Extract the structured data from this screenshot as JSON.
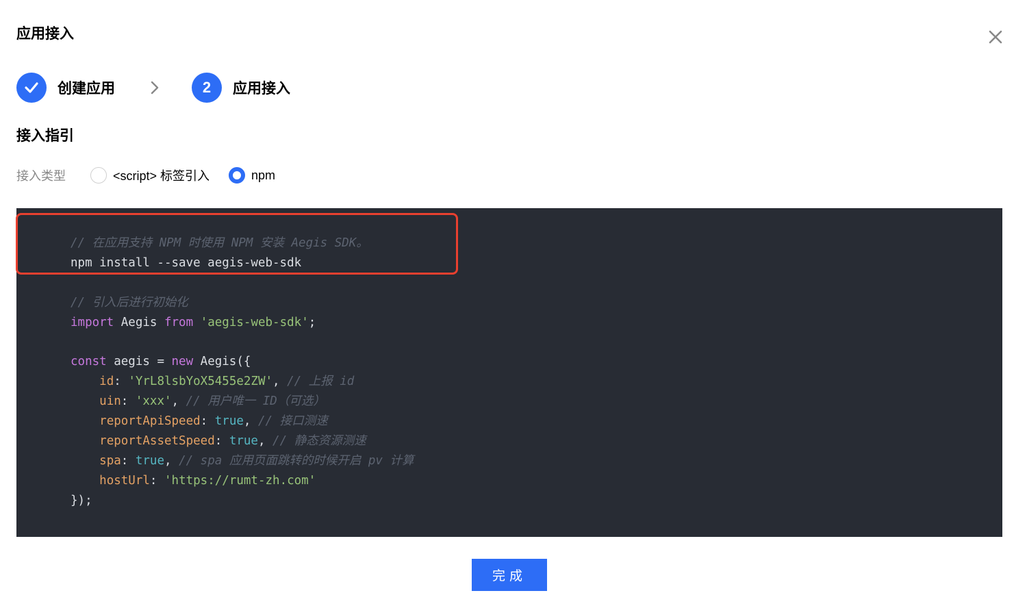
{
  "dialog": {
    "title": "应用接入",
    "close_icon": "close-icon"
  },
  "steps": [
    {
      "label": "创建应用",
      "status": "done",
      "icon": "check-icon"
    },
    {
      "label": "应用接入",
      "status": "current",
      "number": "2"
    }
  ],
  "guide": {
    "section_title": "接入指引",
    "type_label": "接入类型",
    "options": [
      {
        "label": "<script> 标签引入",
        "selected": false
      },
      {
        "label": "npm",
        "selected": true
      }
    ]
  },
  "code": {
    "lines": [
      {
        "indent": "",
        "tokens": [
          {
            "t": "comment",
            "v": "// 在应用支持 NPM 时使用 NPM 安装 Aegis SDK。"
          }
        ]
      },
      {
        "indent": "",
        "tokens": [
          {
            "t": "plain",
            "v": "npm install --save aegis-web-sdk"
          }
        ]
      },
      {
        "indent": "",
        "tokens": []
      },
      {
        "indent": "",
        "tokens": [
          {
            "t": "comment",
            "v": "// 引入后进行初始化"
          }
        ]
      },
      {
        "indent": "",
        "tokens": [
          {
            "t": "kw",
            "v": "import"
          },
          {
            "t": "plain",
            "v": " Aegis "
          },
          {
            "t": "kw",
            "v": "from"
          },
          {
            "t": "plain",
            "v": " "
          },
          {
            "t": "str",
            "v": "'aegis-web-sdk'"
          },
          {
            "t": "plain",
            "v": ";"
          }
        ]
      },
      {
        "indent": "",
        "tokens": []
      },
      {
        "indent": "",
        "tokens": [
          {
            "t": "kw",
            "v": "const"
          },
          {
            "t": "plain",
            "v": " aegis = "
          },
          {
            "t": "kw",
            "v": "new"
          },
          {
            "t": "plain",
            "v": " Aegis({"
          }
        ]
      },
      {
        "indent": "    ",
        "tokens": [
          {
            "t": "prop",
            "v": "id"
          },
          {
            "t": "plain",
            "v": ": "
          },
          {
            "t": "str",
            "v": "'YrL8lsbYoX5455e2ZW'"
          },
          {
            "t": "plain",
            "v": ", "
          },
          {
            "t": "comment",
            "v": "// 上报 id"
          }
        ]
      },
      {
        "indent": "    ",
        "tokens": [
          {
            "t": "prop",
            "v": "uin"
          },
          {
            "t": "plain",
            "v": ": "
          },
          {
            "t": "str",
            "v": "'xxx'"
          },
          {
            "t": "plain",
            "v": ", "
          },
          {
            "t": "comment",
            "v": "// 用户唯一 ID（可选）"
          }
        ]
      },
      {
        "indent": "    ",
        "tokens": [
          {
            "t": "prop",
            "v": "reportApiSpeed"
          },
          {
            "t": "plain",
            "v": ": "
          },
          {
            "t": "bool",
            "v": "true"
          },
          {
            "t": "plain",
            "v": ", "
          },
          {
            "t": "comment",
            "v": "// 接口测速"
          }
        ]
      },
      {
        "indent": "    ",
        "tokens": [
          {
            "t": "prop",
            "v": "reportAssetSpeed"
          },
          {
            "t": "plain",
            "v": ": "
          },
          {
            "t": "bool",
            "v": "true"
          },
          {
            "t": "plain",
            "v": ", "
          },
          {
            "t": "comment",
            "v": "// 静态资源测速"
          }
        ]
      },
      {
        "indent": "    ",
        "tokens": [
          {
            "t": "prop",
            "v": "spa"
          },
          {
            "t": "plain",
            "v": ": "
          },
          {
            "t": "bool",
            "v": "true"
          },
          {
            "t": "plain",
            "v": ", "
          },
          {
            "t": "comment",
            "v": "// spa 应用页面跳转的时候开启 pv 计算"
          }
        ]
      },
      {
        "indent": "    ",
        "tokens": [
          {
            "t": "prop",
            "v": "hostUrl"
          },
          {
            "t": "plain",
            "v": ": "
          },
          {
            "t": "str",
            "v": "'https://rumt-zh.com'"
          }
        ]
      },
      {
        "indent": "",
        "tokens": [
          {
            "t": "plain",
            "v": "});"
          }
        ]
      }
    ]
  },
  "footer": {
    "done_label": "完成"
  },
  "colors": {
    "accent": "#2d6df6",
    "code_bg": "#282c34",
    "highlight_border": "#e8402f"
  }
}
